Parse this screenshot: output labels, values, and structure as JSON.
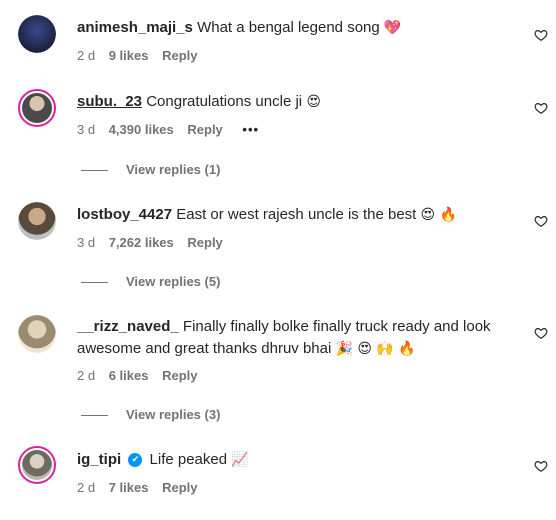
{
  "comments": [
    {
      "username": "animesh_maji_s",
      "text": "What a bengal legend song",
      "emoji": "💖",
      "time": "2 d",
      "likes": "9 likes",
      "reply": "Reply",
      "avatar_color": "#1b1f3a"
    },
    {
      "username": "subu._23",
      "text": "Congratulations uncle ji",
      "emoji": "😍",
      "time": "3 d",
      "likes": "4,390 likes",
      "reply": "Reply",
      "more": "•••",
      "view_replies": "View replies (1)",
      "avatar_color": "#9aa0a6"
    },
    {
      "username": "lostboy_4427",
      "text": "East or west rajesh uncle is the best",
      "emoji": "😍 🔥",
      "time": "3 d",
      "likes": "7,262 likes",
      "reply": "Reply",
      "view_replies": "View replies (5)",
      "avatar_color": "#6b5a4a"
    },
    {
      "username": "__rizz_naved_",
      "text": "Finally finally bolke finally truck ready and look awesome and great thanks dhruv bhai",
      "emoji": "🎉 😍 🙌 🔥",
      "time": "2 d",
      "likes": "6 likes",
      "reply": "Reply",
      "view_replies": "View replies (3)",
      "avatar_color": "#c9b89a"
    },
    {
      "username": "ig_tipi",
      "text": "Life peaked",
      "emoji": "📈",
      "time": "2 d",
      "likes": "7 likes",
      "reply": "Reply",
      "verified_icon": "✔",
      "avatar_color": "#8a8f86"
    }
  ]
}
